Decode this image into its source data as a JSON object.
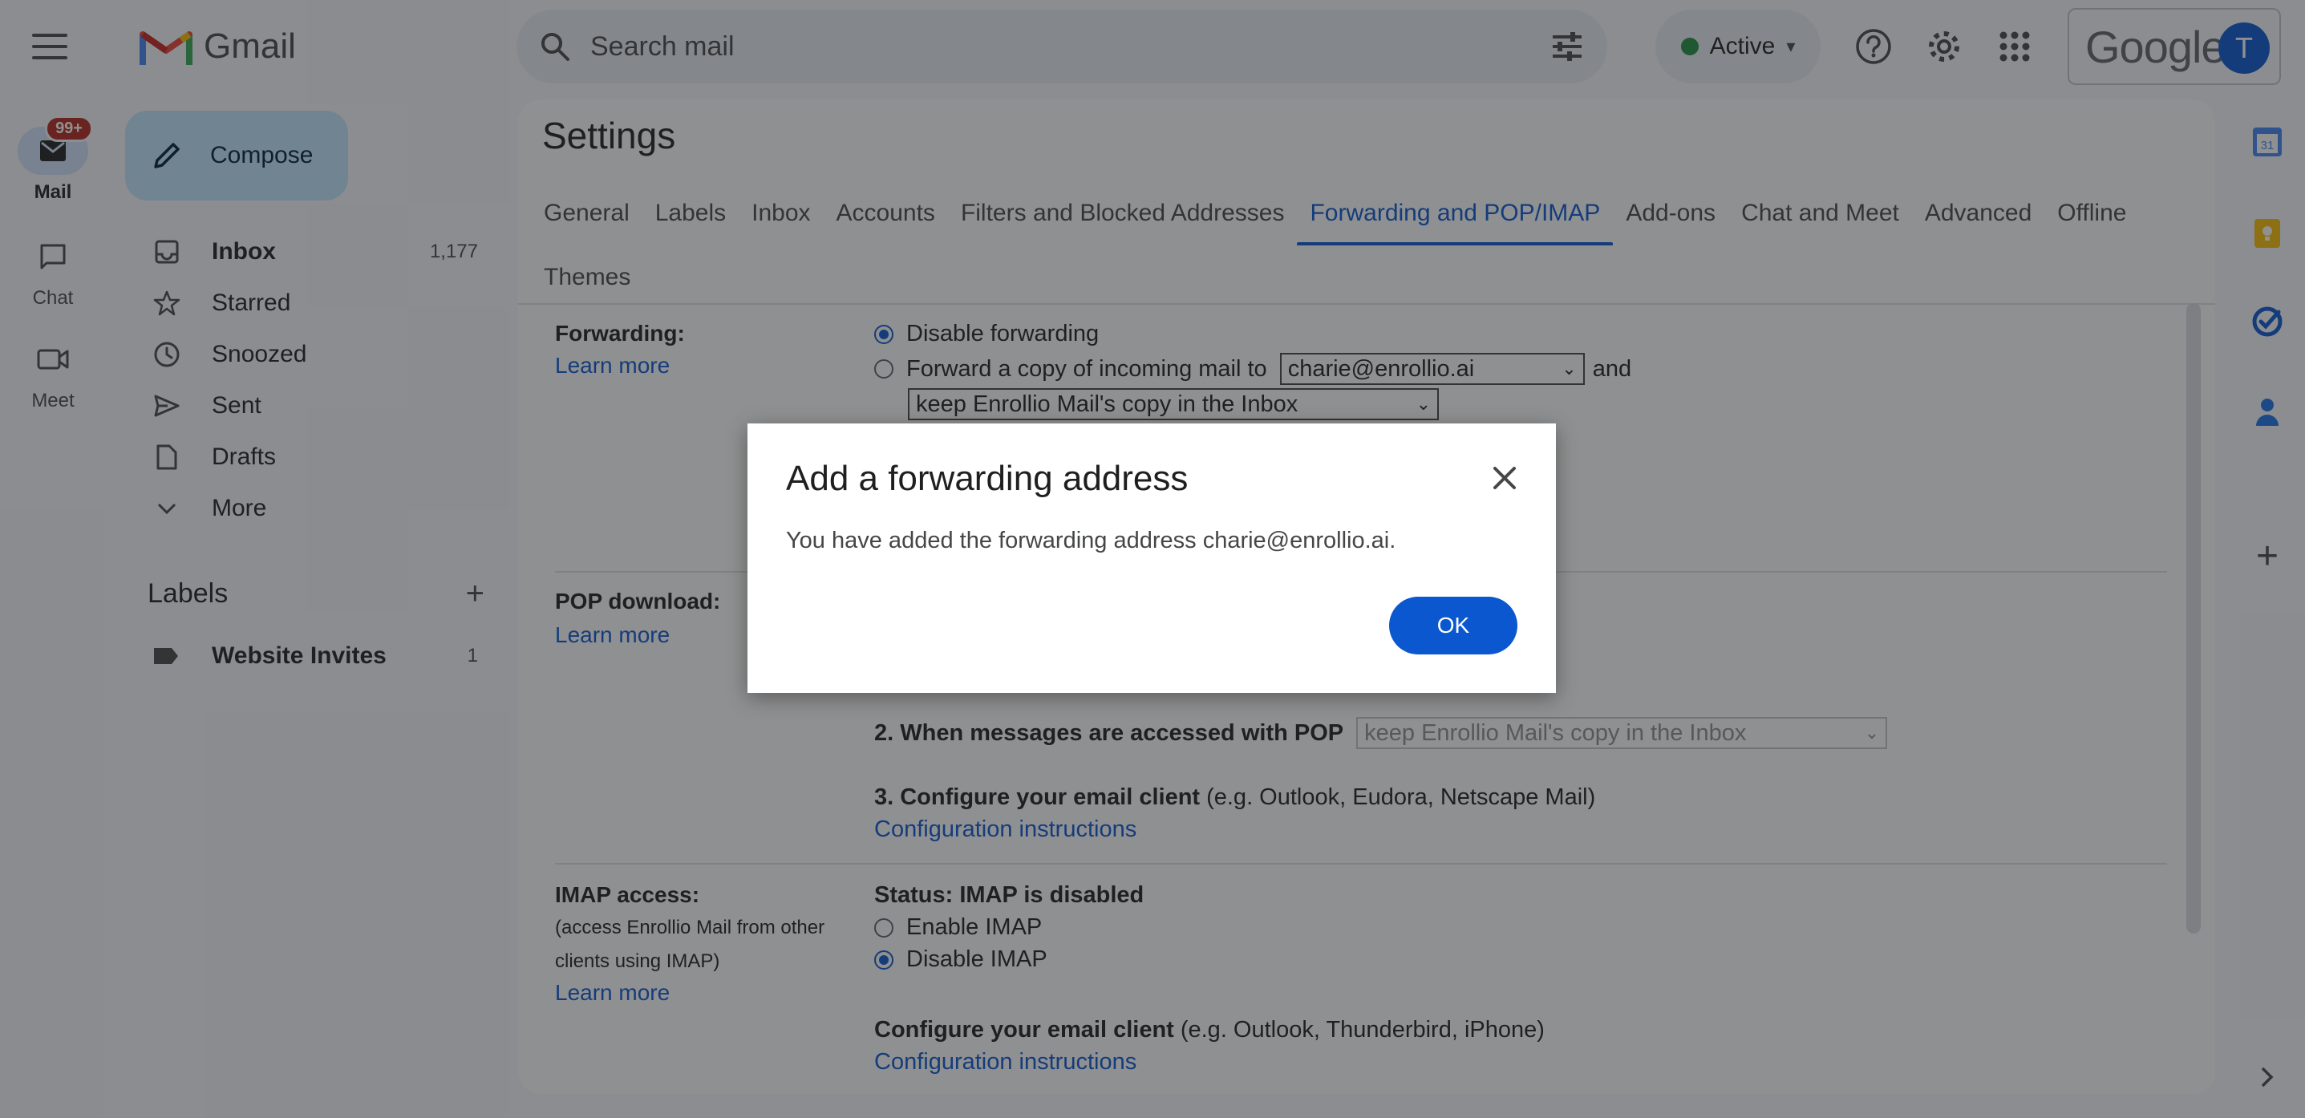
{
  "app": {
    "logo_text": "Gmail",
    "google_word": "Google",
    "avatar_letter": "T"
  },
  "rail": {
    "mail_label": "Mail",
    "mail_badge": "99+",
    "chat_label": "Chat",
    "meet_label": "Meet"
  },
  "search": {
    "placeholder": "Search mail"
  },
  "status": {
    "label": "Active",
    "chevron": "▾"
  },
  "compose": {
    "label": "Compose"
  },
  "nav": {
    "items": [
      {
        "label": "Inbox",
        "count": "1,177"
      },
      {
        "label": "Starred"
      },
      {
        "label": "Snoozed"
      },
      {
        "label": "Sent"
      },
      {
        "label": "Drafts"
      },
      {
        "label": "More"
      }
    ]
  },
  "labels": {
    "header": "Labels",
    "add": "+",
    "items": [
      {
        "label": "Website Invites",
        "count": "1"
      }
    ]
  },
  "settings": {
    "title": "Settings",
    "tabs": [
      "General",
      "Labels",
      "Inbox",
      "Accounts",
      "Filters and Blocked Addresses",
      "Forwarding and POP/IMAP",
      "Add-ons",
      "Chat and Meet",
      "Advanced",
      "Offline",
      "Themes"
    ],
    "forwarding": {
      "label": "Forwarding:",
      "learn_more": "Learn more",
      "disable": "Disable forwarding",
      "forward_copy": "Forward a copy of incoming mail to",
      "address": "charie@enrollio.ai",
      "and": "and",
      "keep_option": "keep Enrollio Mail's copy in the Inbox",
      "partial_link": "!"
    },
    "pop": {
      "label": "POP download:",
      "learn_more": "Learn more",
      "step2": "2. When messages are accessed with POP",
      "step2_option": "keep Enrollio Mail's copy in the Inbox",
      "step3": "3. Configure your email client",
      "step3_hint": "(e.g. Outlook, Eudora, Netscape Mail)",
      "config": "Configuration instructions"
    },
    "imap": {
      "label": "IMAP access:",
      "desc": "(access Enrollio Mail from other clients using IMAP)",
      "learn_more": "Learn more",
      "status": "Status: IMAP is disabled",
      "enable": "Enable IMAP",
      "disable": "Disable IMAP",
      "configure": "Configure your email client",
      "configure_hint": "(e.g. Outlook, Thunderbird, iPhone)",
      "config": "Configuration instructions"
    }
  },
  "dialog": {
    "title": "Add a forwarding address",
    "message": "You have added the forwarding address charie@enrollio.ai.",
    "ok": "OK"
  },
  "side_panel": {
    "calendar_day": "31",
    "add": "+"
  },
  "colors": {
    "accent": "#0b57d0",
    "compose_bg": "#c2e7ff",
    "badge": "#b3261e",
    "active_dot": "#1e8e3e"
  }
}
